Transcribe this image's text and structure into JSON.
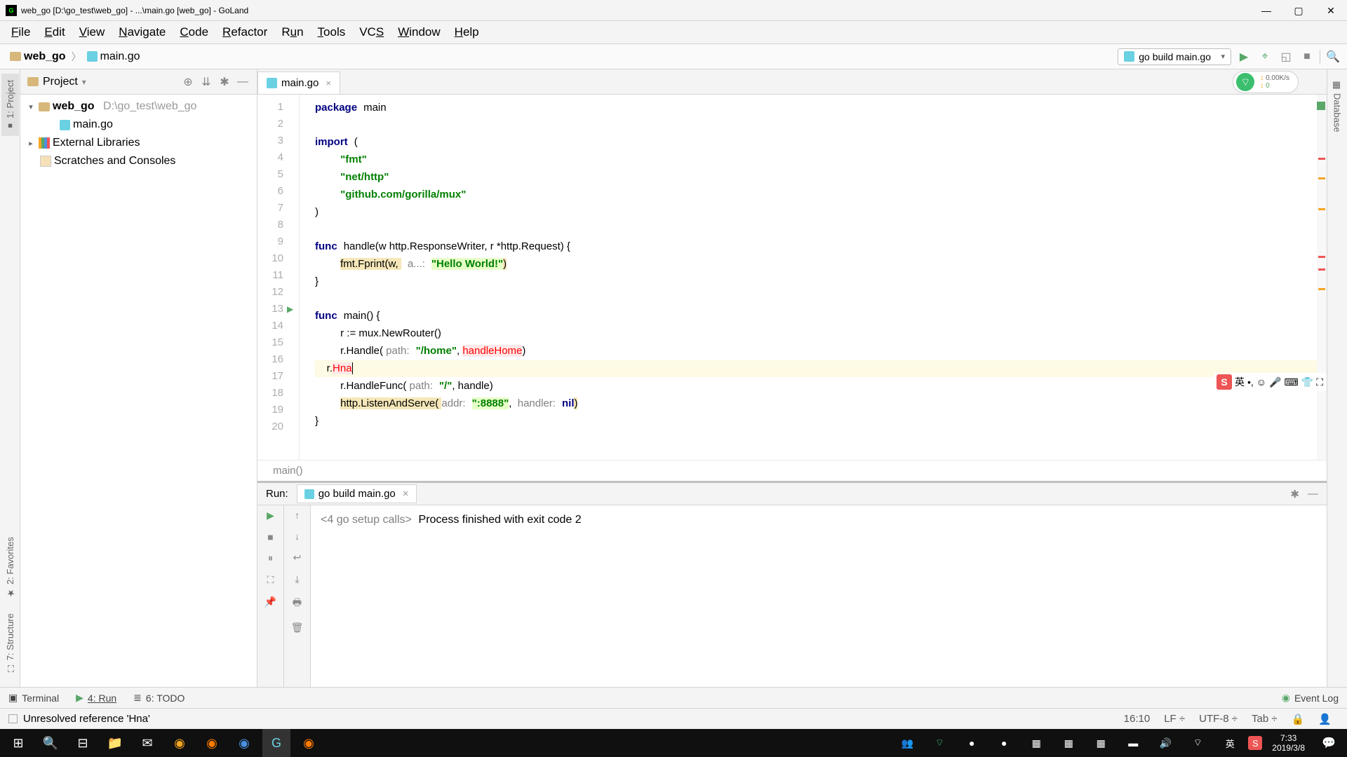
{
  "title": "web_go [D:\\go_test\\web_go] - ...\\main.go [web_go] - GoLand",
  "menu": [
    "File",
    "Edit",
    "View",
    "Navigate",
    "Code",
    "Refactor",
    "Run",
    "Tools",
    "VCS",
    "Window",
    "Help"
  ],
  "breadcrumb": {
    "project": "web_go",
    "file": "main.go"
  },
  "run_config": "go build main.go",
  "net": {
    "speed": "0.00K/s",
    "bytes": "0"
  },
  "project_panel": {
    "title": "Project",
    "root": {
      "name": "web_go",
      "path": "D:\\go_test\\web_go"
    },
    "file": "main.go",
    "ext_lib": "External Libraries",
    "scratch": "Scratches and Consoles"
  },
  "left_tabs": [
    "1: Project",
    "2: Favorites",
    "7: Structure"
  ],
  "right_tabs": [
    "Database"
  ],
  "editor": {
    "tab": "main.go",
    "breadcrumb": "main()",
    "lines": [
      1,
      2,
      3,
      4,
      5,
      6,
      7,
      8,
      9,
      10,
      11,
      12,
      13,
      14,
      15,
      16,
      17,
      18,
      19,
      20
    ],
    "run_marker_line": 13
  },
  "code": {
    "l1_kw": "package",
    "l1_id": "main",
    "l3_kw": "import",
    "l3_paren": "(",
    "l4": "\"fmt\"",
    "l5": "\"net/http\"",
    "l6": "\"github.com/gorilla/mux\"",
    "l7": ")",
    "l9_kw": "func",
    "l9_sig": "handle(w http.ResponseWriter, r *http.Request) {",
    "l10_call": "fmt.Fprint(w, ",
    "l10_param": "a...:",
    "l10_str": "\"Hello World!\"",
    "l10_end": ")",
    "l11": "}",
    "l13_kw": "func",
    "l13_sig": "main() {",
    "l14": "r := mux.NewRouter()",
    "l15_a": "r.Handle( ",
    "l15_param": "path:",
    "l15_str": "\"/home\"",
    "l15_b": ", ",
    "l15_err": "handleHome",
    "l15_c": ")",
    "l16_a": "r.",
    "l16_err": "Hna",
    "l17_a": "r.HandleFunc( ",
    "l17_param": "path:",
    "l17_str": "\"/\"",
    "l17_b": ", handle)",
    "l18_a": "http.ListenAndServe( ",
    "l18_param1": "addr:",
    "l18_str": "\":8888\"",
    "l18_b": ",  ",
    "l18_param2": "handler:",
    "l18_nil": "nil",
    "l18_c": ")",
    "l19": "}"
  },
  "run_panel": {
    "label": "Run:",
    "tab": "go build main.go",
    "line1": "<4 go setup calls>",
    "line2": "Process finished with exit code 2"
  },
  "bottom_tabs": {
    "terminal": "Terminal",
    "run": "4: Run",
    "todo": "6: TODO",
    "event": "Event Log"
  },
  "status": {
    "msg": "Unresolved reference 'Hna'",
    "pos": "16:10",
    "le": "LF",
    "enc": "UTF-8",
    "indent": "Tab"
  },
  "clock": {
    "time": "7:33",
    "date": "2019/3/8"
  },
  "ime": "英"
}
